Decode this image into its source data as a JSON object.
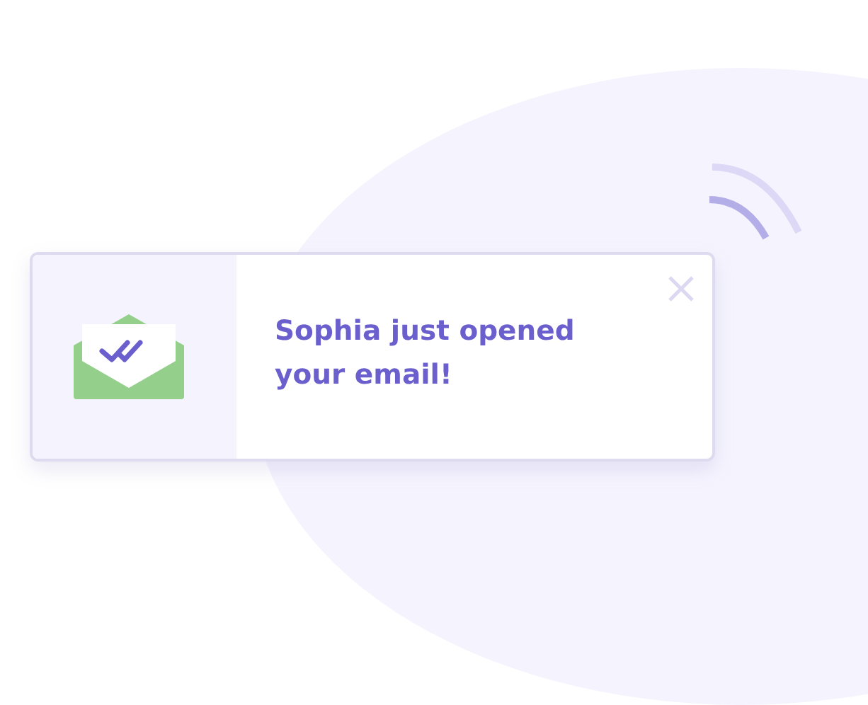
{
  "notification": {
    "message": "Sophia just opened your email!"
  }
}
